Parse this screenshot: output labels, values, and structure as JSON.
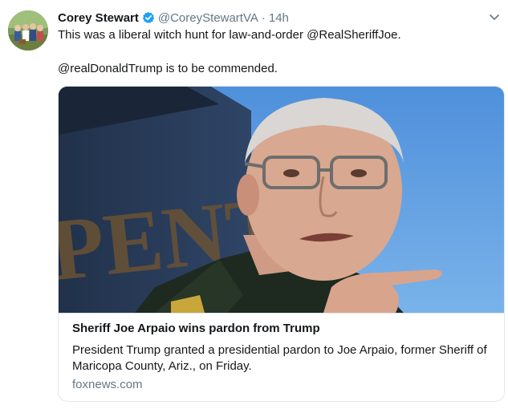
{
  "tweet": {
    "name": "Corey Stewart",
    "handle": "@CoreyStewartVA",
    "separator": "·",
    "time": "14h",
    "line1": "This was a liberal witch hunt for law-and-order @RealSheriffJoe.",
    "line2": "@realDonaldTrump is to be commended."
  },
  "card": {
    "title": "Sheriff Joe Arpaio wins pardon from Trump",
    "description": "President Trump granted a presidential pardon to Joe Arpaio, former Sheriff of Maricopa County, Ariz., on Friday.",
    "domain": "foxnews.com",
    "image_sign_text": "PENT"
  },
  "colors": {
    "verified": "#1da1f2",
    "muted": "#657786",
    "border": "#e1e8ed",
    "sky": "#5b9be0"
  },
  "icons": [
    "verified-badge-icon",
    "chevron-down-icon",
    "avatar"
  ]
}
